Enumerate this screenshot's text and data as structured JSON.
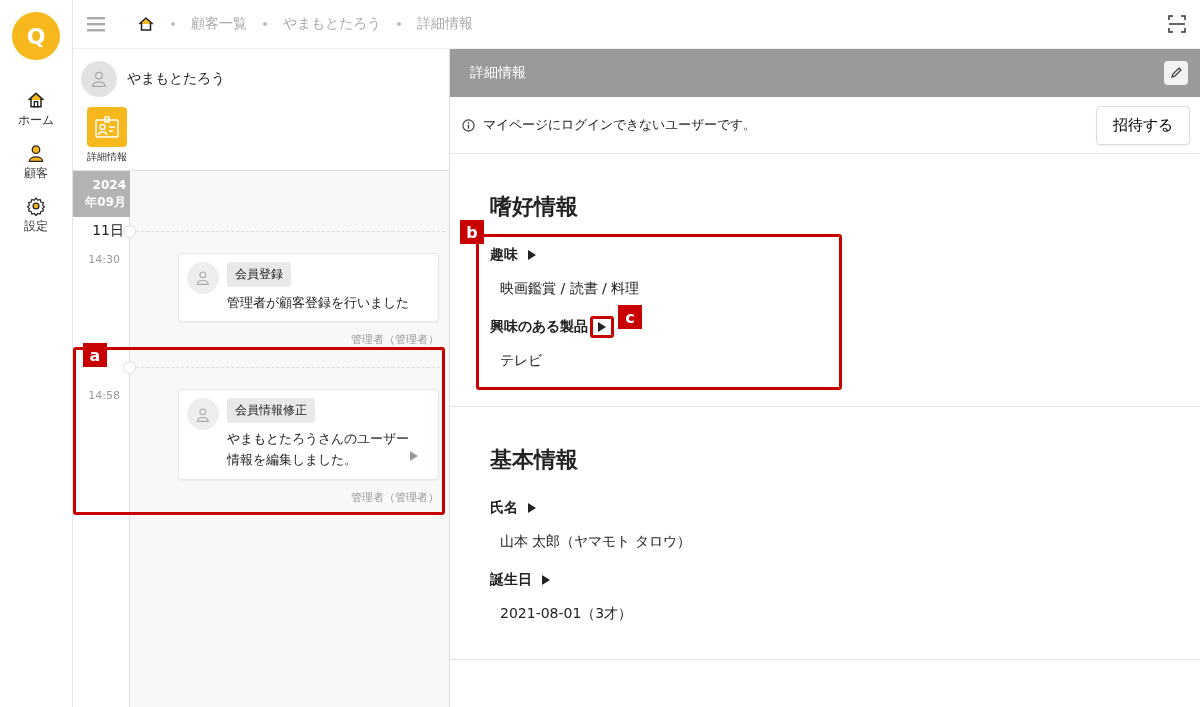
{
  "sidebar": {
    "logo": "Q",
    "items": [
      {
        "label": "ホーム",
        "kind": "home"
      },
      {
        "label": "顧客",
        "kind": "person"
      },
      {
        "label": "設定",
        "kind": "gear"
      }
    ]
  },
  "breadcrumb": [
    "顧客一覧",
    "やまもとたろう",
    "詳細情報"
  ],
  "customer": {
    "name": "やまもとたろう",
    "tabs": [
      {
        "label": "詳細情報",
        "selected": true
      }
    ]
  },
  "timeline": {
    "year": "2024",
    "month": "年09月",
    "days": [
      {
        "date": "11日",
        "events": [
          {
            "time": "14:30",
            "tag": "会員登録",
            "text": "管理者が顧客登録を行いました",
            "author": "管理者（管理者）",
            "expandable": false
          }
        ]
      },
      {
        "annotation": "a",
        "events": [
          {
            "time": "14:58",
            "tag": "会員情報修正",
            "text": "やまもとたろうさんのユーザー情報を編集しました。",
            "author": "管理者（管理者）",
            "expandable": true
          }
        ]
      }
    ]
  },
  "details": {
    "title": "詳細情報",
    "notice": "マイページにログインできないユーザーです。",
    "invite_button": "招待する",
    "sections": [
      {
        "title": "嗜好情報",
        "annotation": "b",
        "fields": [
          {
            "label": "趣味",
            "value": "映画鑑賞 / 読書 / 料理"
          },
          {
            "label": "興味のある製品",
            "value": "テレビ",
            "annotation": "c"
          }
        ]
      },
      {
        "title": "基本情報",
        "fields": [
          {
            "label": "氏名",
            "value": "山本 太郎（ヤマモト タロウ）"
          },
          {
            "label": "誕生日",
            "value": "2021-08-01（3才）"
          }
        ]
      }
    ]
  }
}
